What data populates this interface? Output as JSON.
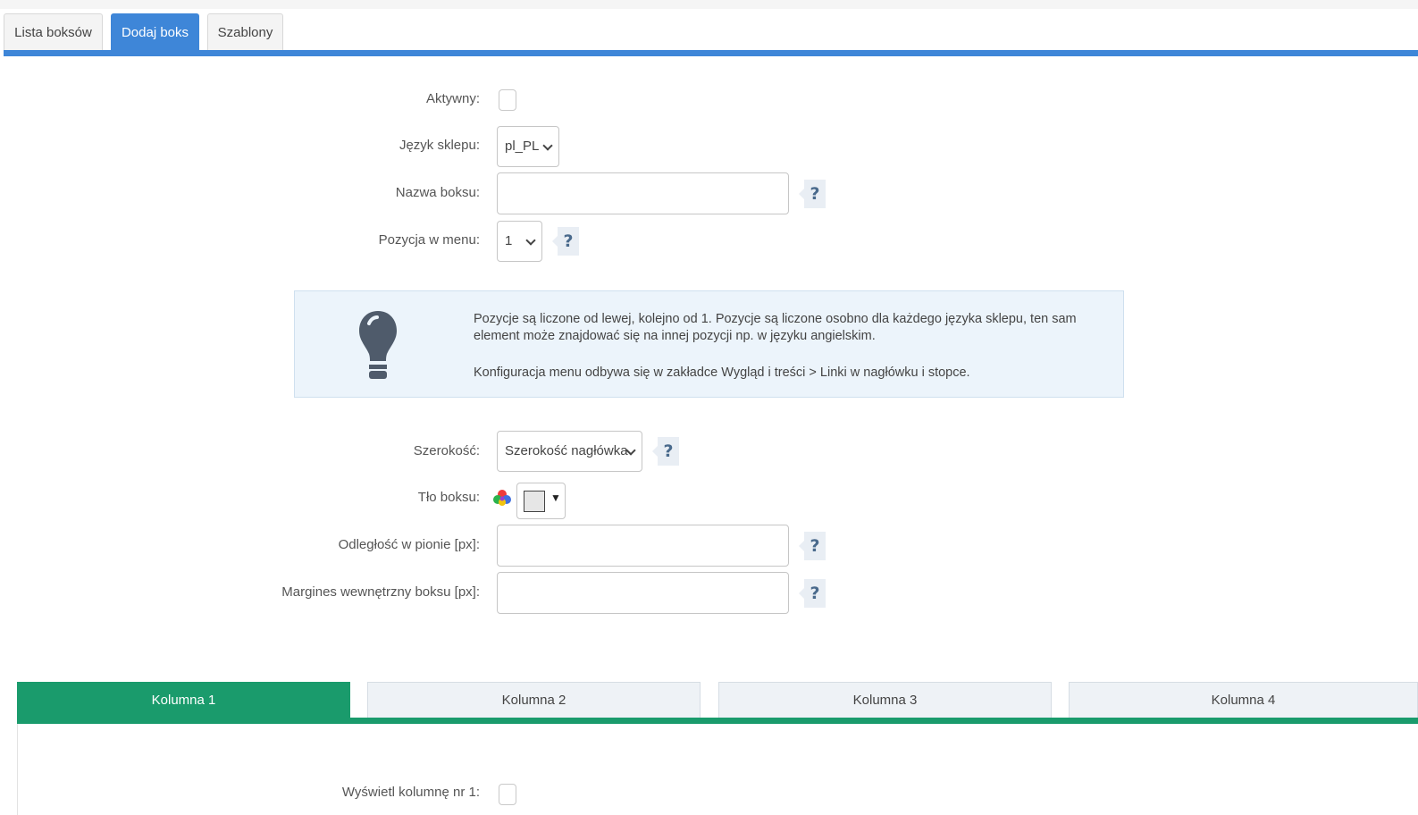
{
  "tabs": [
    {
      "label": "Lista boksów"
    },
    {
      "label": "Dodaj boks"
    },
    {
      "label": "Szablony"
    }
  ],
  "form": {
    "aktywny_label": "Aktywny:",
    "jezyk_label": "Język sklepu:",
    "jezyk_value": "pl_PL",
    "nazwa_label": "Nazwa boksu:",
    "nazwa_value": "",
    "pozycja_label": "Pozycja w menu:",
    "pozycja_value": "1",
    "szerokosc_label": "Szerokość:",
    "szerokosc_value": "Szerokość nagłówka",
    "tlo_label": "Tło boksu:",
    "odleglosc_label": "Odległość w pionie [px]:",
    "odleglosc_value": "",
    "margines_label": "Margines wewnętrzny boksu [px]:",
    "margines_value": "",
    "help_glyph": "?"
  },
  "info": {
    "line1": "Pozycje są liczone od lewej, kolejno od 1. Pozycje są liczone osobno dla każdego języka sklepu, ten sam element może znajdować się na innej pozycji np. w języku angielskim.",
    "line2": "Konfiguracja menu odbywa się w zakładce Wygląd i treści > Linki w nagłówku i stopce."
  },
  "columns": {
    "tabs": [
      {
        "label": "Kolumna 1"
      },
      {
        "label": "Kolumna 2"
      },
      {
        "label": "Kolumna 3"
      },
      {
        "label": "Kolumna 4"
      }
    ],
    "wyswietl_label": "Wyświetl kolumnę nr 1:"
  },
  "colors": {
    "tab_active": "#3e86d8",
    "column_tab_active": "#1a9b6c",
    "info_bg": "#ecf4fb"
  },
  "icons": [
    "lightbulb-icon",
    "color-wheel-icon",
    "help-icon",
    "chevron-down-icon"
  ]
}
